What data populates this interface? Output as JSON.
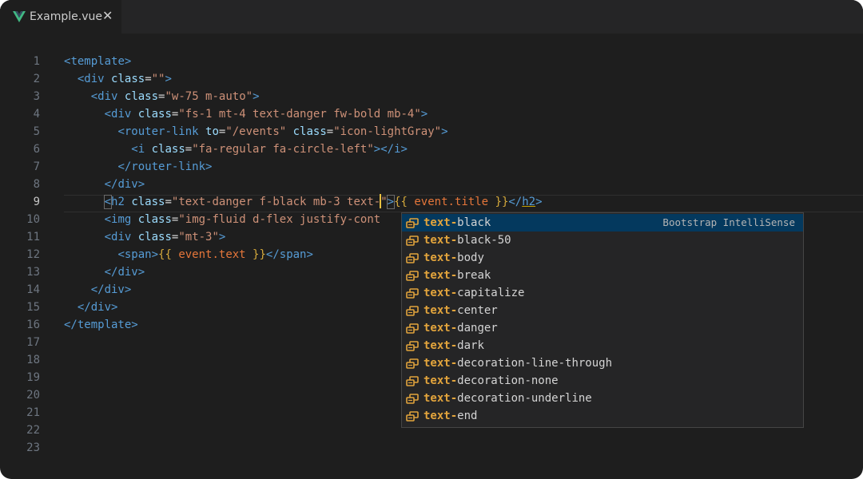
{
  "tab": {
    "filename": "Example.vue",
    "close_glyph": "✕",
    "icon": "vue-logo-icon"
  },
  "active_line": 9,
  "lines": [
    {
      "num": "1",
      "segments": [
        [
          "<",
          "tag"
        ],
        [
          "template",
          "tag"
        ],
        [
          ">",
          "tag"
        ]
      ]
    },
    {
      "num": "2",
      "segments": [
        [
          "  ",
          "pl"
        ],
        [
          "<",
          "tag"
        ],
        [
          "div",
          "tag"
        ],
        [
          " ",
          "pl"
        ],
        [
          "class",
          "attr"
        ],
        [
          "=",
          "eq"
        ],
        [
          "\"\"",
          "str"
        ],
        [
          ">",
          "tag"
        ]
      ]
    },
    {
      "num": "3",
      "segments": [
        [
          "    ",
          "pl"
        ],
        [
          "<",
          "tag"
        ],
        [
          "div",
          "tag"
        ],
        [
          " ",
          "pl"
        ],
        [
          "class",
          "attr"
        ],
        [
          "=",
          "eq"
        ],
        [
          "\"w-75 m-auto\"",
          "str"
        ],
        [
          ">",
          "tag"
        ]
      ]
    },
    {
      "num": "4",
      "segments": [
        [
          "      ",
          "pl"
        ],
        [
          "<",
          "tag"
        ],
        [
          "div",
          "tag"
        ],
        [
          " ",
          "pl"
        ],
        [
          "class",
          "attr"
        ],
        [
          "=",
          "eq"
        ],
        [
          "\"fs-1 mt-4 text-danger fw-bold mb-4\"",
          "str"
        ],
        [
          ">",
          "tag"
        ]
      ]
    },
    {
      "num": "5",
      "segments": [
        [
          "        ",
          "pl"
        ],
        [
          "<",
          "tag"
        ],
        [
          "router-link",
          "tag"
        ],
        [
          " ",
          "pl"
        ],
        [
          "to",
          "attr"
        ],
        [
          "=",
          "eq"
        ],
        [
          "\"/events\"",
          "str"
        ],
        [
          " ",
          "pl"
        ],
        [
          "class",
          "attr"
        ],
        [
          "=",
          "eq"
        ],
        [
          "\"icon-lightGray\"",
          "str"
        ],
        [
          ">",
          "tag"
        ]
      ]
    },
    {
      "num": "6",
      "segments": [
        [
          "          ",
          "pl"
        ],
        [
          "<",
          "tag"
        ],
        [
          "i",
          "tag"
        ],
        [
          " ",
          "pl"
        ],
        [
          "class",
          "attr"
        ],
        [
          "=",
          "eq"
        ],
        [
          "\"fa-regular fa-circle-left\"",
          "str"
        ],
        [
          "></",
          "tag"
        ],
        [
          "i",
          "tag"
        ],
        [
          ">",
          "tag"
        ]
      ]
    },
    {
      "num": "7",
      "segments": [
        [
          "        ",
          "pl"
        ],
        [
          "</",
          "tag"
        ],
        [
          "router-link",
          "tag"
        ],
        [
          ">",
          "tag"
        ]
      ]
    },
    {
      "num": "8",
      "segments": [
        [
          "      ",
          "pl"
        ],
        [
          "</",
          "tag"
        ],
        [
          "div",
          "tag"
        ],
        [
          ">",
          "tag"
        ]
      ]
    },
    {
      "num": "9",
      "segments": [
        [
          "      ",
          "pl"
        ],
        [
          "<",
          "tag match"
        ],
        [
          "h2",
          "tag"
        ],
        [
          " ",
          "pl"
        ],
        [
          "class",
          "attr"
        ],
        [
          "=",
          "eq"
        ],
        [
          "\"text-danger f-black mb-3 text-",
          "str"
        ],
        [
          "|",
          "caret"
        ],
        [
          "\"",
          "str"
        ],
        [
          ">",
          "tag match"
        ],
        [
          "{{",
          "mus"
        ],
        [
          " event.title ",
          "expr"
        ],
        [
          "}}",
          "mus"
        ],
        [
          "</",
          "tag"
        ],
        [
          "h2",
          "tag under"
        ],
        [
          ">",
          "tag"
        ]
      ]
    },
    {
      "num": "10",
      "segments": [
        [
          "      ",
          "pl"
        ],
        [
          "<",
          "tag"
        ],
        [
          "img",
          "tag"
        ],
        [
          " ",
          "pl"
        ],
        [
          "class",
          "attr"
        ],
        [
          "=",
          "eq"
        ],
        [
          "\"img-fluid d-flex justify-cont",
          "str"
        ]
      ]
    },
    {
      "num": "11",
      "segments": [
        [
          "      ",
          "pl"
        ],
        [
          "<",
          "tag"
        ],
        [
          "div",
          "tag"
        ],
        [
          " ",
          "pl"
        ],
        [
          "class",
          "attr"
        ],
        [
          "=",
          "eq"
        ],
        [
          "\"mt-3\"",
          "str"
        ],
        [
          ">",
          "tag"
        ]
      ]
    },
    {
      "num": "12",
      "segments": [
        [
          "        ",
          "pl"
        ],
        [
          "<",
          "tag"
        ],
        [
          "span",
          "tag"
        ],
        [
          ">",
          "tag"
        ],
        [
          "{{",
          "mus"
        ],
        [
          " event.text ",
          "expr"
        ],
        [
          "}}",
          "mus"
        ],
        [
          "</",
          "tag"
        ],
        [
          "span",
          "tag"
        ],
        [
          ">",
          "tag"
        ]
      ]
    },
    {
      "num": "13",
      "segments": [
        [
          "      ",
          "pl"
        ],
        [
          "</",
          "tag"
        ],
        [
          "div",
          "tag"
        ],
        [
          ">",
          "tag"
        ]
      ]
    },
    {
      "num": "14",
      "segments": [
        [
          "    ",
          "pl"
        ],
        [
          "</",
          "tag"
        ],
        [
          "div",
          "tag"
        ],
        [
          ">",
          "tag"
        ]
      ]
    },
    {
      "num": "15",
      "segments": [
        [
          "  ",
          "pl"
        ],
        [
          "</",
          "tag"
        ],
        [
          "div",
          "tag"
        ],
        [
          ">",
          "tag"
        ]
      ]
    },
    {
      "num": "16",
      "segments": [
        [
          "</",
          "tag"
        ],
        [
          "template",
          "tag"
        ],
        [
          ">",
          "tag"
        ]
      ]
    },
    {
      "num": "17",
      "segments": []
    },
    {
      "num": "18",
      "segments": []
    },
    {
      "num": "19",
      "segments": []
    },
    {
      "num": "20",
      "segments": []
    },
    {
      "num": "21",
      "segments": []
    },
    {
      "num": "22",
      "segments": []
    },
    {
      "num": "23",
      "segments": []
    }
  ],
  "suggest": {
    "typed_prefix": "text-",
    "detail": "Bootstrap IntelliSense",
    "icon": "class-icon",
    "selected_index": 0,
    "items": [
      "text-black",
      "text-black-50",
      "text-body",
      "text-break",
      "text-capitalize",
      "text-center",
      "text-danger",
      "text-dark",
      "text-decoration-line-through",
      "text-decoration-none",
      "text-decoration-underline",
      "text-end"
    ]
  },
  "colors": {
    "background": "#1e1e1e",
    "tag": "#569cd6",
    "attribute": "#9cdcfe",
    "string": "#ce9178",
    "mustache": "#d4a93b",
    "expression": "#e5763a",
    "suggest_match": "#e2a43c",
    "suggest_selected_bg": "#04395e"
  }
}
